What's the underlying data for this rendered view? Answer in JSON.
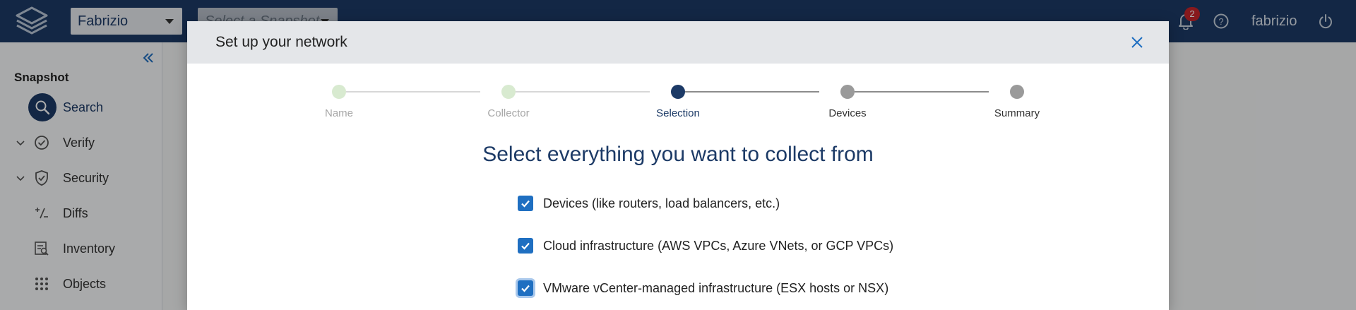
{
  "topbar": {
    "org_select_value": "Fabrizio",
    "snapshot_select_placeholder": "Select a Snapshot",
    "notification_count": "2",
    "username": "fabrizio"
  },
  "sidebar": {
    "heading": "Snapshot",
    "items": [
      {
        "label": "Search",
        "icon": "search-icon",
        "active": true
      },
      {
        "label": "Verify",
        "icon": "check-circle-icon"
      },
      {
        "label": "Security",
        "icon": "shield-check-icon"
      },
      {
        "label": "Diffs",
        "icon": "diff-icon"
      },
      {
        "label": "Inventory",
        "icon": "inventory-icon"
      },
      {
        "label": "Objects",
        "icon": "grid-icon"
      }
    ]
  },
  "modal": {
    "title": "Set up your network",
    "steps": [
      {
        "label": "Name",
        "state": "done"
      },
      {
        "label": "Collector",
        "state": "done"
      },
      {
        "label": "Selection",
        "state": "current"
      },
      {
        "label": "Devices",
        "state": "pending"
      },
      {
        "label": "Summary",
        "state": "pending"
      }
    ],
    "heading": "Select everything you want to collect from",
    "options": [
      {
        "label": "Devices (like routers, load balancers, etc.)",
        "checked": true
      },
      {
        "label": "Cloud infrastructure (AWS VPCs, Azure VNets, or GCP VPCs)",
        "checked": true
      },
      {
        "label": "VMware vCenter-managed infrastructure (ESX hosts or NSX)",
        "checked": true
      }
    ]
  },
  "colors": {
    "topbar": "#1c3a66",
    "accent": "#1c3a66",
    "checkbox": "#1f6fc1",
    "step_done": "#d8ead0",
    "step_pending": "#9a9a9a",
    "badge": "#c8252c"
  }
}
